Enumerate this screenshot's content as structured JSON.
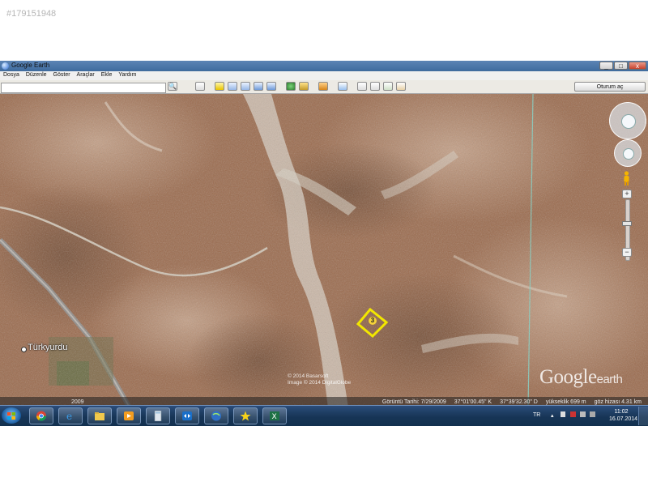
{
  "listing_id": "#179151948",
  "window": {
    "title": "Google Earth",
    "controls": {
      "minimize": "_",
      "maximize": "□",
      "close": "x"
    }
  },
  "menu": [
    "Dosya",
    "Düzenle",
    "Göster",
    "Araçlar",
    "Ekle",
    "Yardım"
  ],
  "toolbar": {
    "search_value": "",
    "search_button": "🔍",
    "login_label": "Oturum aç",
    "icons": [
      "sidebar-icon",
      "placemark-icon",
      "polygon-icon",
      "path-icon",
      "image-overlay-icon",
      "tour-icon",
      "sky-icon",
      "sunlight-icon",
      "historical-imagery-icon",
      "ruler-icon",
      "email-icon",
      "print-icon",
      "maps-icon"
    ]
  },
  "map": {
    "village_label": "Türkyurdu",
    "parcel_label": "3",
    "parcel_color": "#f2e700",
    "watermark_google": "Google",
    "watermark_earth": "earth",
    "copyright_line1": "© 2014 Basarsoft",
    "copyright_line2": "Image © 2014 DigitalGlobe",
    "year_badge": "2009",
    "status": {
      "imagery_date": "Görüntü Tarihi: 7/29/2009",
      "latitude": "37°01'00.45\" K",
      "longitude": "37°39'32.30\" D",
      "elevation": "yükseklik 699 m",
      "eye_altitude": "göz hizası 4.31 km"
    }
  },
  "taskbar": {
    "apps": [
      "chrome-icon",
      "internet-explorer-icon",
      "explorer-folder-icon",
      "media-player-icon",
      "calculator-icon",
      "teamviewer-icon",
      "google-earth-icon",
      "yellow-star-icon",
      "excel-icon"
    ],
    "language": "TR",
    "time": "11:02",
    "date": "16.07.2014"
  },
  "colors": {
    "title_bar": "#4a76a8",
    "taskbar": "#1c3a5e",
    "terrain": "#9b6a4c"
  }
}
